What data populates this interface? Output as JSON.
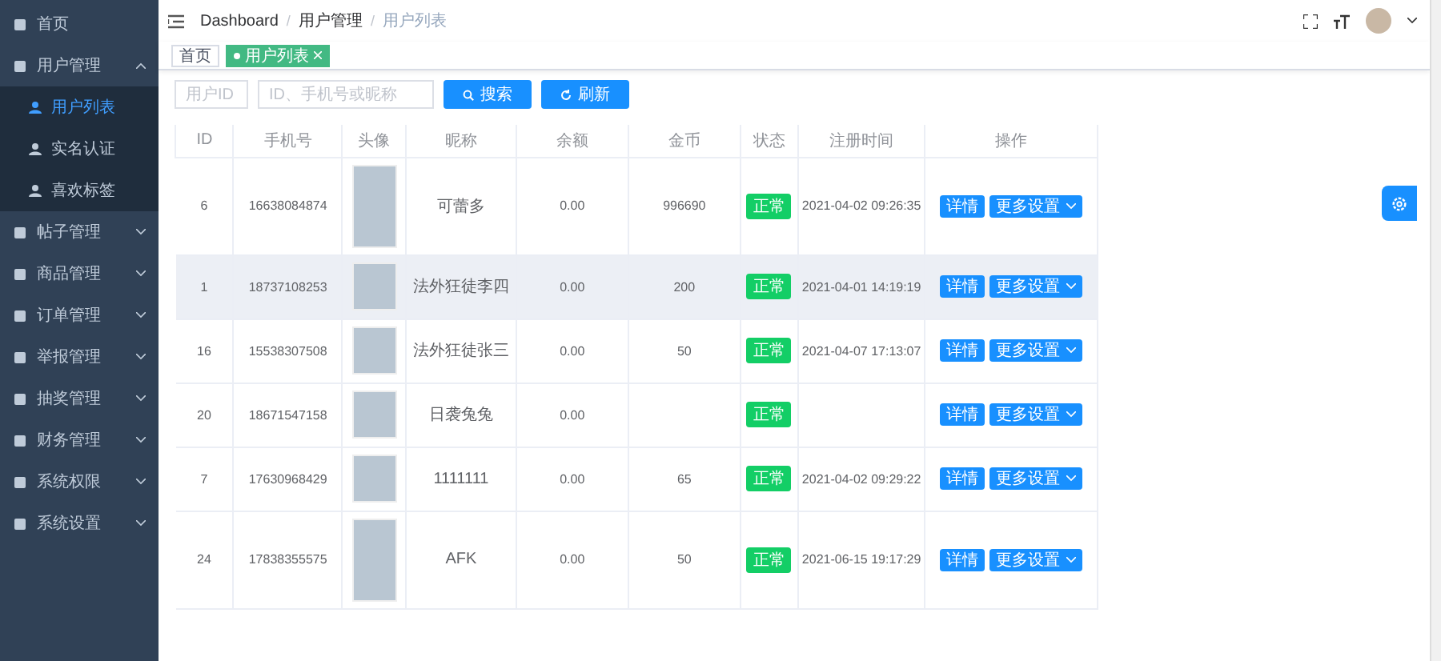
{
  "sidebar": {
    "items": [
      {
        "label": "首页",
        "selected": false
      },
      {
        "label": "用户管理",
        "expanded": true,
        "selected": false,
        "children": [
          {
            "label": "用户列表",
            "selected": true
          },
          {
            "label": "实名认证",
            "selected": false
          },
          {
            "label": "喜欢标签",
            "selected": false
          }
        ]
      },
      {
        "label": "帖子管理",
        "expanded": false,
        "selected": false
      },
      {
        "label": "商品管理",
        "expanded": false,
        "selected": false
      },
      {
        "label": "订单管理",
        "expanded": false,
        "selected": false
      },
      {
        "label": "举报管理",
        "expanded": false,
        "selected": false
      },
      {
        "label": "抽奖管理",
        "expanded": false,
        "selected": false
      },
      {
        "label": "财务管理",
        "expanded": false,
        "selected": false
      },
      {
        "label": "系统权限",
        "expanded": false,
        "selected": false
      },
      {
        "label": "系统设置",
        "expanded": false,
        "selected": false
      }
    ]
  },
  "breadcrumb": {
    "items": [
      "Dashboard",
      "用户管理",
      "用户列表"
    ],
    "separator": "/"
  },
  "tags": [
    {
      "label": "首页",
      "selected": false
    },
    {
      "label": "用户列表",
      "selected": true
    }
  ],
  "search": {
    "fields": [
      {
        "placeholder": "用户ID"
      },
      {
        "placeholder": "ID、手机号或昵称"
      }
    ],
    "buttons": [
      "搜索",
      "刷新"
    ]
  },
  "table": {
    "columns": [
      "ID",
      "手机号",
      "头像",
      "昵称",
      "余额",
      "金币",
      "状态",
      "注册时间",
      "操作"
    ],
    "rows": [
      {
        "id": "6",
        "phone": "16638084874",
        "avatar": {
          "kind": "tall"
        },
        "nickname": "可蕾多",
        "balance": "0.00",
        "coins": "996690",
        "status": "正常",
        "time": "2021-04-02 09:26:35",
        "actions": [
          "详情",
          "更多设置"
        ],
        "selected": false
      },
      {
        "id": "1",
        "phone": "18737108253",
        "avatar": {
          "kind": "square"
        },
        "nickname": "法外狂徒李四",
        "balance": "0.00",
        "coins": "200",
        "status": "正常",
        "time": "2021-04-01 14:19:19",
        "actions": [
          "详情",
          "更多设置"
        ],
        "selected": true
      },
      {
        "id": "16",
        "phone": "15538307508",
        "avatar": {
          "kind": "square"
        },
        "nickname": "法外狂徒张三",
        "balance": "0.00",
        "coins": "50",
        "status": "正常",
        "time": "2021-04-07 17:13:07",
        "actions": [
          "详情",
          "更多设置"
        ],
        "selected": false
      },
      {
        "id": "20",
        "phone": "18671547158",
        "avatar": {
          "kind": "square"
        },
        "nickname": "日袭兔兔",
        "balance": "0.00",
        "status": "正常",
        "actions": [
          "详情",
          "更多设置"
        ],
        "selected": false
      },
      {
        "id": "7",
        "phone": "17630968429",
        "avatar": {
          "kind": "square"
        },
        "nickname": "1111111",
        "balance": "0.00",
        "coins": "65",
        "status": "正常",
        "time": "2021-04-02 09:29:22",
        "actions": [
          "详情",
          "更多设置"
        ],
        "selected": false
      },
      {
        "id": "24",
        "phone": "17838355575",
        "avatar": {
          "kind": "tall"
        },
        "nickname": "AFK",
        "balance": "0.00",
        "coins": "50",
        "status": "正常",
        "time": "2021-06-15 19:17:29",
        "actions": [
          "详情",
          "更多设置"
        ],
        "selected": false
      }
    ]
  }
}
